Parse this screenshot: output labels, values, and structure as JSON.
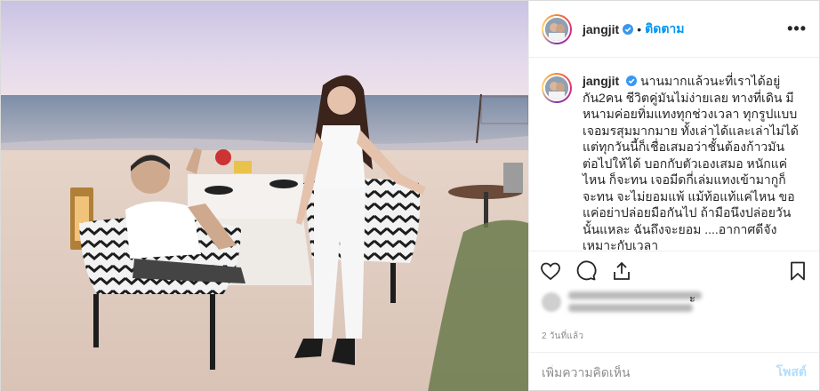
{
  "post": {
    "username": "jangjit",
    "follow_label": "ติดตาม",
    "separator": "•",
    "more_label": "•••",
    "caption_username": "jangjit",
    "caption_body": "นานมากแล้วนะที่เราได้อยู่กัน2คน ชีวิตคู่มันไม่ง่ายเลย ทางที่เดิน มีหนามค่อยทิ่มแทงทุกช่วงเวลา ทุกรูปแบบ เจอมรสุมมากมาย ทั้งเล่าได้และเล่าไม่ได้ แต่ทุกวันนี้ก็เชื่อเสมอว่าชั้นต้องก้าวมันต่อไปให้ได้ บอกกับตัวเองเสมอ หนักแค่ไหน ก็จะทน เจอมีดกี่เล่มแทงเข้ามากูก็จะทน จะไม่ยอมแพ้ แม้ท้อแท้แค่ไหน ขอแค่อย่าปล่อยมือกันไป ถ้ามือนึงปล่อยวันนั้นแหละ ฉันถึงจะยอม ....อากาศดีจัง เหมาะกับเวลา",
    "likes_tail": "ะ",
    "time_label": "2 วันที่แล้ว",
    "comment_placeholder": "เพิ่มความคิดเห็น",
    "post_label": "โพสต์"
  },
  "icons": {
    "verified": "verified-badge-icon",
    "like": "heart-icon",
    "comment": "comment-icon",
    "share": "share-icon",
    "save": "bookmark-icon",
    "more": "more-options-icon"
  },
  "colors": {
    "link_blue": "#0095f6",
    "post_disabled": "#b2dffc",
    "muted": "#8e8e8e",
    "text": "#262626"
  }
}
